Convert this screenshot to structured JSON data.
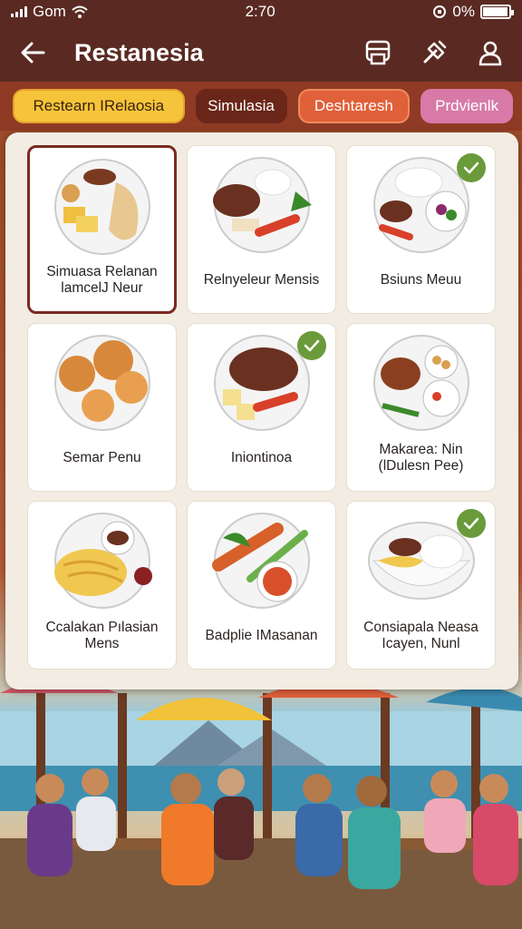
{
  "status": {
    "carrier": "Gom",
    "time": "2:70",
    "battery": "0%",
    "battery_level": 0.95
  },
  "header": {
    "title": "Restanesia"
  },
  "icons": {
    "back": "arrow-left-icon",
    "actions": [
      "printer-icon",
      "tools-icon",
      "user-icon"
    ]
  },
  "chips": [
    {
      "label": "Restearn IRelaosia"
    },
    {
      "label": "Simulasia"
    },
    {
      "label": "Deshtaresh"
    },
    {
      "label": "Prdvienlk"
    }
  ],
  "menu": [
    {
      "label": "Simuasa Relanan\nlamcelJ Neur",
      "selected": true,
      "checked": false
    },
    {
      "label": "Relnyeleur Mensis",
      "selected": false,
      "checked": false
    },
    {
      "label": "Bsiuns Meuu",
      "selected": false,
      "checked": true
    },
    {
      "label": "Semar Penu",
      "selected": false,
      "checked": false
    },
    {
      "label": "Iniontinoa",
      "selected": false,
      "checked": true
    },
    {
      "label": "Makarea: Nin\n(lDulesn Pee)",
      "selected": false,
      "checked": false
    },
    {
      "label": "Ccalakan Pılasian\nMens",
      "selected": false,
      "checked": false
    },
    {
      "label": "Badplie IMasanan",
      "selected": false,
      "checked": false
    },
    {
      "label": "Consiapala Neasa\nIcayen, Nunl",
      "selected": false,
      "checked": true
    }
  ],
  "colors": {
    "header": "#5a2a22",
    "chip_bar": "#8e3a24",
    "check": "#6a9a3a"
  }
}
